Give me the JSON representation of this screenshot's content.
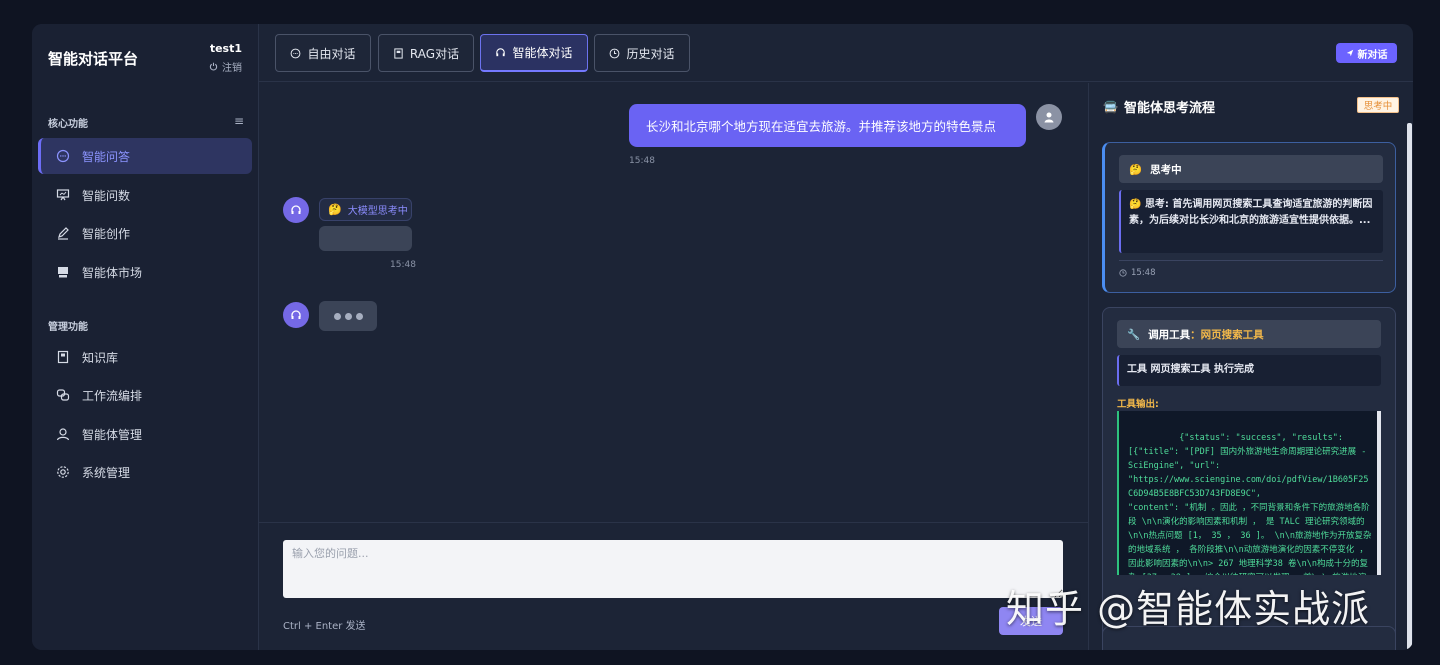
{
  "sidebar": {
    "brand": "智能对话平台",
    "user": {
      "name": "test1",
      "logout": "注销"
    },
    "core_section": "核心功能",
    "core_items": [
      {
        "label": "智能问答",
        "icon": "chat-icon",
        "active": true
      },
      {
        "label": "智能问数",
        "icon": "chart-board-icon",
        "active": false
      },
      {
        "label": "智能创作",
        "icon": "pen-icon",
        "active": false
      },
      {
        "label": "智能体市场",
        "icon": "store-icon",
        "active": false
      }
    ],
    "manage_section": "管理功能",
    "manage_items": [
      {
        "label": "知识库",
        "icon": "book-icon"
      },
      {
        "label": "工作流编排",
        "icon": "link-icon"
      },
      {
        "label": "智能体管理",
        "icon": "user-icon"
      },
      {
        "label": "系统管理",
        "icon": "gear-icon"
      }
    ]
  },
  "tabs": [
    {
      "label": "自由对话",
      "icon": "chat-icon",
      "active": false
    },
    {
      "label": "RAG对话",
      "icon": "book-icon",
      "active": false
    },
    {
      "label": "智能体对话",
      "icon": "headset-icon",
      "active": true
    },
    {
      "label": "历史对话",
      "icon": "clock-icon",
      "active": false
    }
  ],
  "new_chat": "新对话",
  "chat": {
    "user_message": "长沙和北京哪个地方现在适宜去旅游。并推荐该地方的特色景点",
    "user_time": "15:48",
    "thinking_chip": "大模型思考中",
    "bot_time": "15:48",
    "input_placeholder": "输入您的问题...",
    "hint": "Ctrl + Enter 发送",
    "send": "发送"
  },
  "panel": {
    "title": "智能体思考流程",
    "badge": "思考中",
    "card1": {
      "header": "思考中",
      "body": "思考: 首先调用网页搜索工具查询适宜旅游的判断因素，为后续对比长沙和北京的旅游适宜性提供依据。...",
      "time": "15:48"
    },
    "card2": {
      "header_prefix": "调用工具",
      "tool_name": "：网页搜索工具",
      "body": "工具 网页搜索工具 执行完成",
      "output_label": "工具输出:",
      "output": "{\"status\": \"success\", \"results\":\n[{\"title\": \"[PDF] 国内外旅游地生命周期理论研究进展 - SciEngine\", \"url\":\n\"https://www.sciengine.com/doi/pdfView/1B605F25C6D94B5E8BFC53D743FD8E9C\",\n\"content\": \"机制 。因此 ，不同背景和条件下的旅游地各阶段 \\n\\n演化的影响因素和机制 ， 是 TALC 理论研究领域的 \\n\\n热点问题 [1， 35 ， 36 ]。 \\n\\n旅游地作为开放复杂的地域系统 ， 各阶段推\\n\\n动旅游地演化的因素不停变化 ， 因此影响因素的\\n\\n> 267 地理科学38 卷\\n\\n构成十分的复杂 [37 ，38 ]， 综合以往研究可以发现 ，首\\n\\n旅游地演化的"
    }
  },
  "watermark": "知乎 @智能体实战派"
}
